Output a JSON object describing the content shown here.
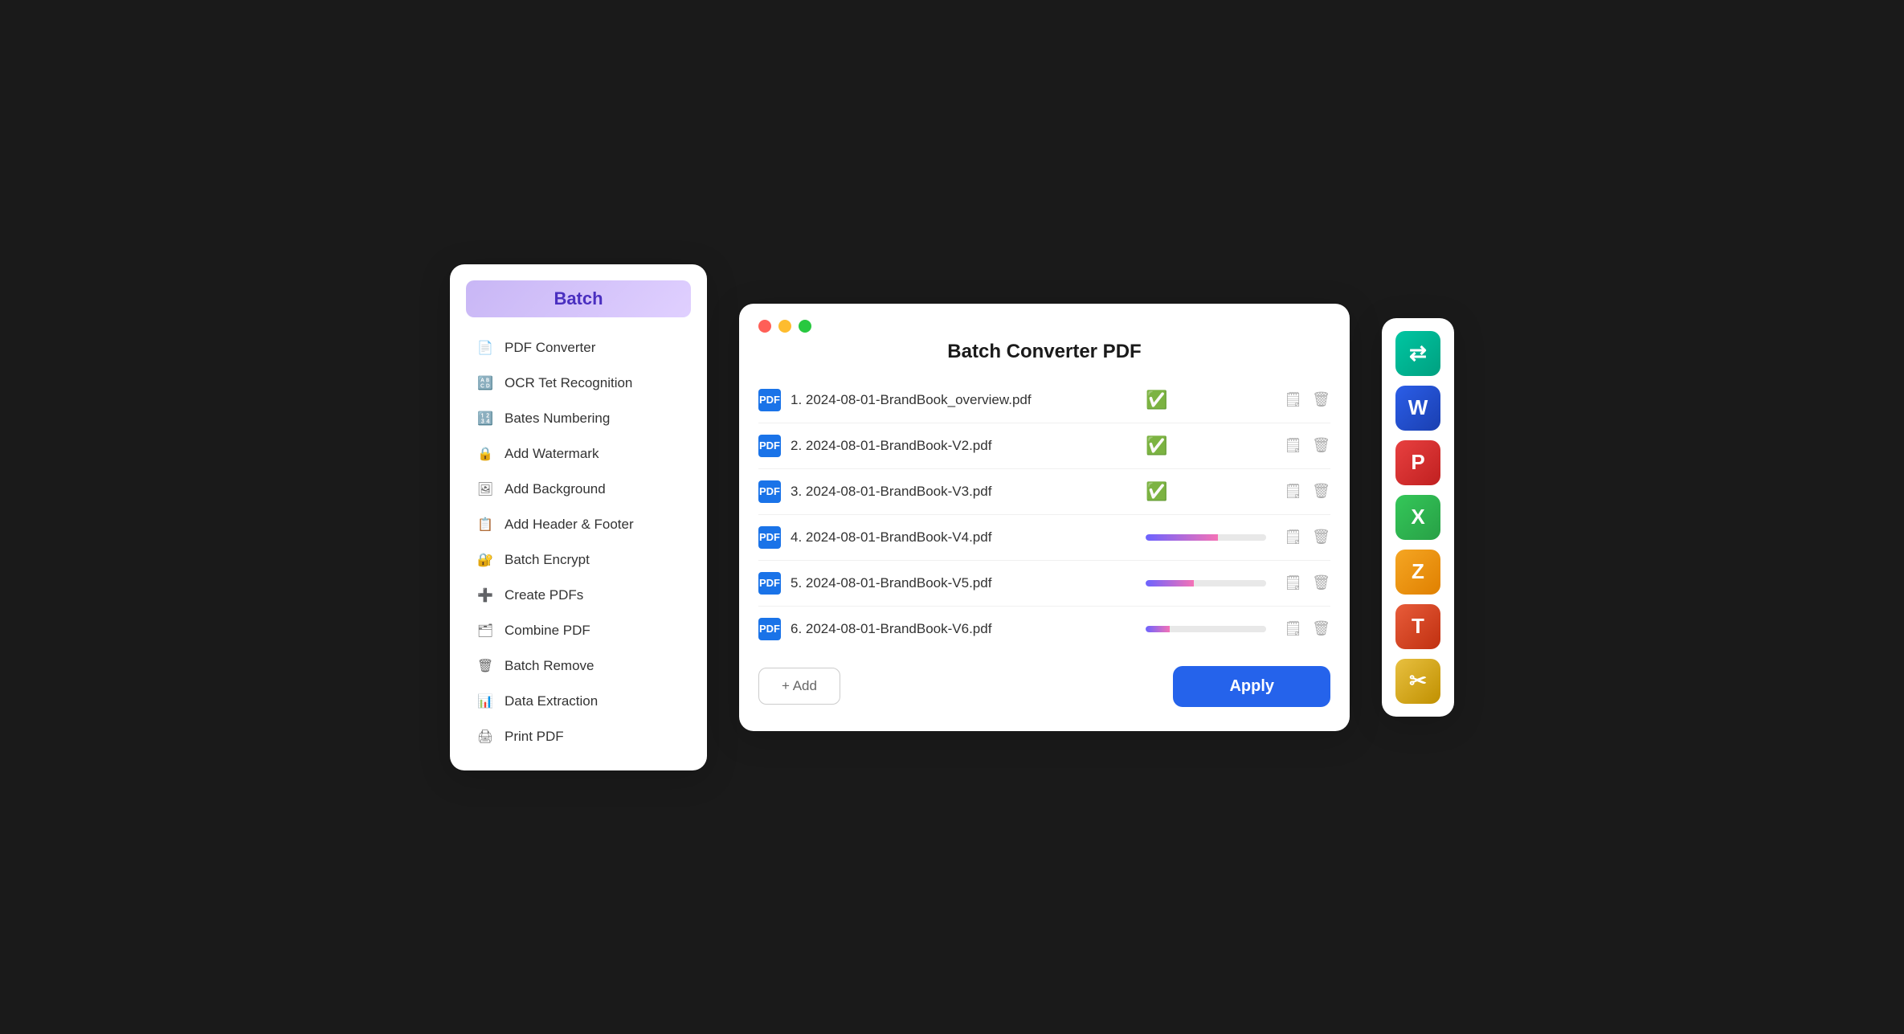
{
  "sidebar": {
    "batch_label": "Batch",
    "items": [
      {
        "id": "pdf-converter",
        "label": "PDF Converter",
        "icon": "📄"
      },
      {
        "id": "ocr-recognition",
        "label": "OCR Tet Recognition",
        "icon": "🔠"
      },
      {
        "id": "bates-numbering",
        "label": "Bates Numbering",
        "icon": "🔢"
      },
      {
        "id": "add-watermark",
        "label": "Add Watermark",
        "icon": "🔒"
      },
      {
        "id": "add-background",
        "label": "Add Background",
        "icon": "🖼"
      },
      {
        "id": "add-header-footer",
        "label": "Add Header & Footer",
        "icon": "📋"
      },
      {
        "id": "batch-encrypt",
        "label": "Batch Encrypt",
        "icon": "🔐"
      },
      {
        "id": "create-pdfs",
        "label": "Create PDFs",
        "icon": "➕"
      },
      {
        "id": "combine-pdf",
        "label": "Combine PDF",
        "icon": "🗂"
      },
      {
        "id": "batch-remove",
        "label": "Batch Remove",
        "icon": "🗑"
      },
      {
        "id": "data-extraction",
        "label": "Data Extraction",
        "icon": "📊"
      },
      {
        "id": "print-pdf",
        "label": "Print PDF",
        "icon": "🖨"
      }
    ]
  },
  "main_panel": {
    "title": "Batch Converter PDF",
    "files": [
      {
        "index": 1,
        "name": "2024-08-01-BrandBook_overview.pdf",
        "status": "done"
      },
      {
        "index": 2,
        "name": "2024-08-01-BrandBook-V2.pdf",
        "status": "done"
      },
      {
        "index": 3,
        "name": "2024-08-01-BrandBook-V3.pdf",
        "status": "done"
      },
      {
        "index": 4,
        "name": "2024-08-01-BrandBook-V4.pdf",
        "status": "progress",
        "progress": 60
      },
      {
        "index": 5,
        "name": "2024-08-01-BrandBook-V5.pdf",
        "status": "progress",
        "progress": 40
      },
      {
        "index": 6,
        "name": "2024-08-01-BrandBook-V6.pdf",
        "status": "progress",
        "progress": 20
      }
    ],
    "add_label": "+ Add",
    "apply_label": "Apply"
  },
  "right_dock": {
    "apps": [
      {
        "id": "pdf-merge",
        "color": "teal",
        "icon": "⇄"
      },
      {
        "id": "word",
        "color": "blue",
        "icon": "W"
      },
      {
        "id": "powerpoint",
        "color": "red",
        "icon": "P"
      },
      {
        "id": "excel",
        "color": "green",
        "icon": "X"
      },
      {
        "id": "edit",
        "color": "orange",
        "icon": "Z"
      },
      {
        "id": "text-edit",
        "color": "red2",
        "icon": "T"
      },
      {
        "id": "photo",
        "color": "yellow",
        "icon": "✂"
      }
    ]
  }
}
